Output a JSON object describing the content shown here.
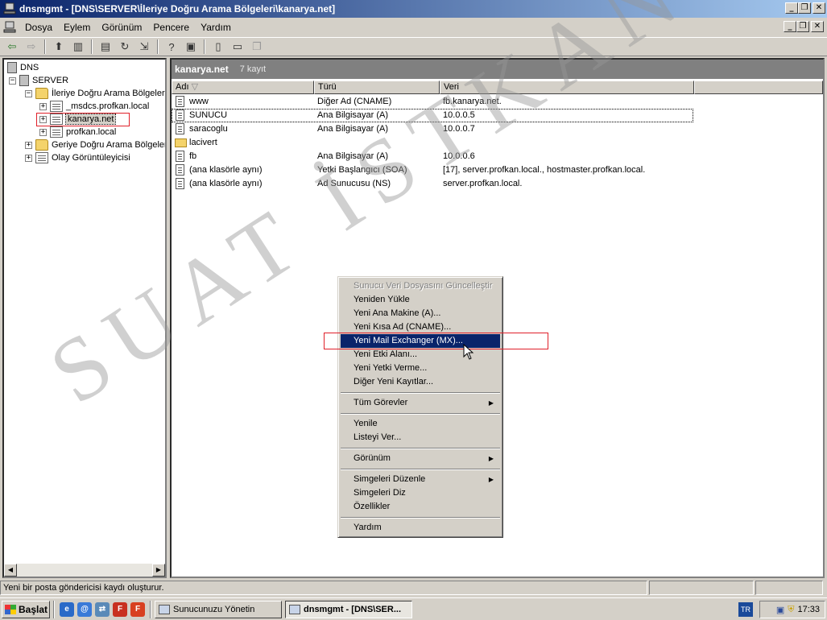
{
  "window": {
    "title": "dnsmgmt - [DNS\\SERVER\\İleriye Doğru Arama Bölgeleri\\kanarya.net]"
  },
  "menubar": {
    "items": [
      {
        "label": "Dosya"
      },
      {
        "label": "Eylem"
      },
      {
        "label": "Görünüm"
      },
      {
        "label": "Pencere"
      },
      {
        "label": "Yardım"
      }
    ]
  },
  "tree": {
    "root": "DNS",
    "server": "SERVER",
    "forward_zones": "İleriye Doğru Arama Bölgeleri",
    "zones": [
      "_msdcs.profkan.local",
      "kanarya.net",
      "profkan.local"
    ],
    "reverse_zones": "Geriye Doğru Arama Bölgeleri",
    "event_viewer": "Olay Görüntüleyicisi"
  },
  "pane": {
    "title": "kanarya.net",
    "count": "7 kayıt",
    "columns": [
      "Adı",
      "Türü",
      "Veri"
    ],
    "rows": [
      {
        "name": "www",
        "type": "Diğer Ad (CNAME)",
        "data": "fb.kanarya.net."
      },
      {
        "name": "SUNUCU",
        "type": "Ana Bilgisayar (A)",
        "data": "10.0.0.5"
      },
      {
        "name": "saracoglu",
        "type": "Ana Bilgisayar (A)",
        "data": "10.0.0.7"
      },
      {
        "name": "lacivert",
        "type": "",
        "data": ""
      },
      {
        "name": "fb",
        "type": "Ana Bilgisayar (A)",
        "data": "10.0.0.6"
      },
      {
        "name": "(ana klasörle aynı)",
        "type": "Yetki Başlangıcı (SOA)",
        "data": "[17], server.profkan.local., hostmaster.profkan.local."
      },
      {
        "name": "(ana klasörle aynı)",
        "type": "Ad Sunucusu (NS)",
        "data": "server.profkan.local."
      }
    ]
  },
  "context_menu": {
    "items": [
      "Sunucu Veri Dosyasını Güncelleştir",
      "Yeniden Yükle",
      "Yeni Ana Makine (A)...",
      "Yeni Kısa Ad (CNAME)...",
      "Yeni Mail Exchanger (MX)...",
      "Yeni Etki Alanı...",
      "Yeni Yetki Verme...",
      "Diğer Yeni Kayıtlar...",
      "Tüm Görevler",
      "Yenile",
      "Listeyi Ver...",
      "Görünüm",
      "Simgeleri Düzenle",
      "Simgeleri Diz",
      "Özellikler",
      "Yardım"
    ]
  },
  "status": {
    "text": "Yeni bir posta göndericisi kaydı oluşturur."
  },
  "taskbar": {
    "start": "Başlat",
    "tasks": [
      "Sunucunuzu Yönetin",
      "dnsmgmt - [DNS\\SER..."
    ],
    "lang": "TR",
    "clock": "17:33"
  },
  "watermark": "SUAT İSTKAN"
}
